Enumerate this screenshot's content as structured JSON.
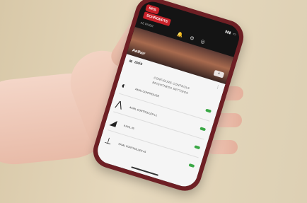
{
  "app": {
    "status_badge": "SRS",
    "brand_tag": "SCHROEDTE",
    "brand_small": "AE RIVER",
    "header_title": "Aether",
    "add_button": "+"
  },
  "panel": {
    "logo_text": "axis",
    "section_title": "CONFIGURE CONTROLS",
    "subsection": "BRIGHTNESS SETTINGS",
    "devices": [
      {
        "label": "AXIAL CONTROLLER",
        "icon": "camera-icon"
      },
      {
        "label": "AXIAL CONTROLLER L1",
        "icon": "tripod-icon"
      },
      {
        "label": "AXIAL 45",
        "icon": "stand-icon"
      },
      {
        "label": "AXIAL CONTROLLER 45",
        "icon": "gimbal-icon"
      }
    ]
  },
  "colors": {
    "phone_case": "#6e1f24",
    "accent_red": "#c8222a",
    "toggle_on": "#3aa845"
  }
}
